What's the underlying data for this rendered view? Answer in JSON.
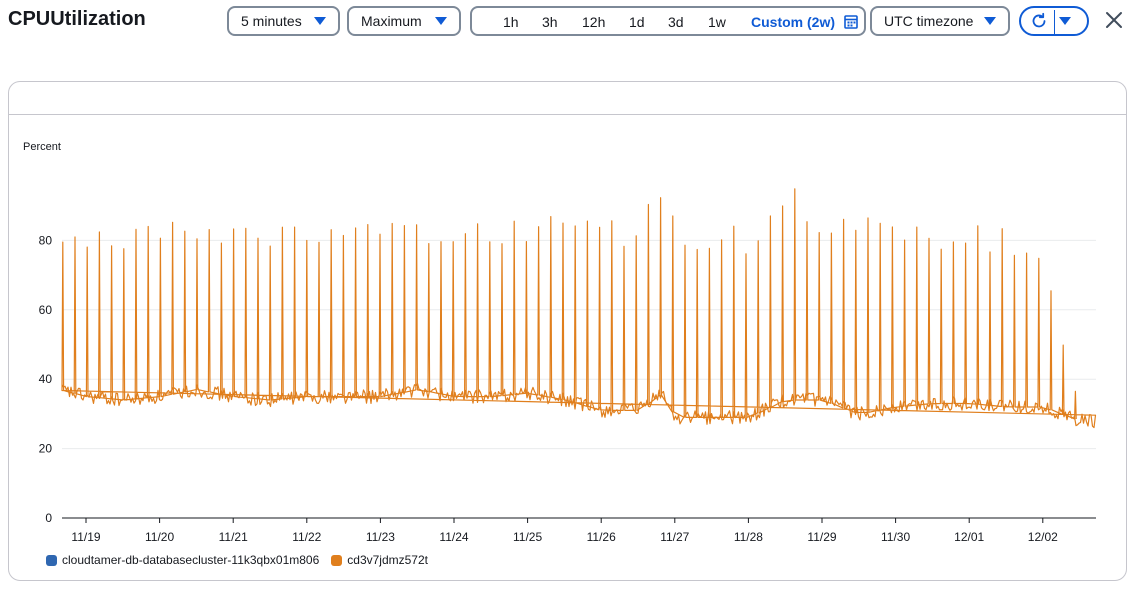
{
  "header": {
    "title": "CPUUtilization",
    "period": "5 minutes",
    "statistic": "Maximum",
    "time_ranges": [
      "1h",
      "3h",
      "12h",
      "1d",
      "3d",
      "1w"
    ],
    "custom_range": "Custom (2w)",
    "timezone": "UTC timezone"
  },
  "colors": {
    "accent": "#0f5bd5",
    "series1": "#2f67b1",
    "series2": "#e07f1d"
  },
  "icons": [
    "caret-down-icon",
    "calendar-icon",
    "refresh-icon",
    "close-icon"
  ],
  "chart_data": {
    "type": "line",
    "ylabel": "Percent",
    "ylim": [
      0,
      100
    ],
    "yticks": [
      0,
      20,
      40,
      60,
      80
    ],
    "categories": [
      "11/19",
      "11/20",
      "11/21",
      "11/22",
      "11/23",
      "11/24",
      "11/25",
      "11/26",
      "11/27",
      "11/28",
      "11/29",
      "11/30",
      "12/01",
      "12/02"
    ],
    "grid": true,
    "legend_position": "bottom-left",
    "series": [
      {
        "name": "cloudtamer-db-databasecluster-11k3qbx01m806",
        "color": "#2f67b1",
        "x": [],
        "values": []
      },
      {
        "name": "cd3v7jdmz572t",
        "color": "#e07f1d",
        "x": [
          "11/18 15:00",
          "11/19 00:00",
          "11/19 12:00",
          "11/20 00:00",
          "11/20 12:00",
          "11/21 00:00",
          "11/21 12:00",
          "11/22 00:00",
          "11/22 12:00",
          "11/23 00:00",
          "11/23 12:00",
          "11/24 00:00",
          "11/24 12:00",
          "11/25 00:00",
          "11/25 12:00",
          "11/26 00:00",
          "11/26 12:00",
          "11/26 20:00",
          "11/27 00:00",
          "11/27 12:00",
          "11/28 00:00",
          "11/28 12:00",
          "11/29 00:00",
          "11/29 12:00",
          "11/30 00:00",
          "11/30 12:00",
          "12/01 00:00",
          "12/01 12:00",
          "12/02 00:00",
          "12/02 12:00"
        ],
        "values": [
          37,
          35,
          34,
          35,
          37,
          35,
          34,
          35,
          35,
          35,
          37,
          35,
          35,
          36,
          34,
          31,
          31,
          36,
          29,
          29,
          29,
          34,
          34,
          30,
          32,
          33,
          33,
          32,
          32,
          28
        ],
        "peak_values": [
          86,
          85,
          86,
          88,
          88,
          87,
          87,
          88,
          87,
          87,
          86,
          87,
          88,
          88,
          87,
          86,
          85,
          99,
          85,
          85,
          84,
          98,
          89,
          88,
          87,
          86,
          86,
          85,
          77,
          37
        ]
      }
    ]
  }
}
